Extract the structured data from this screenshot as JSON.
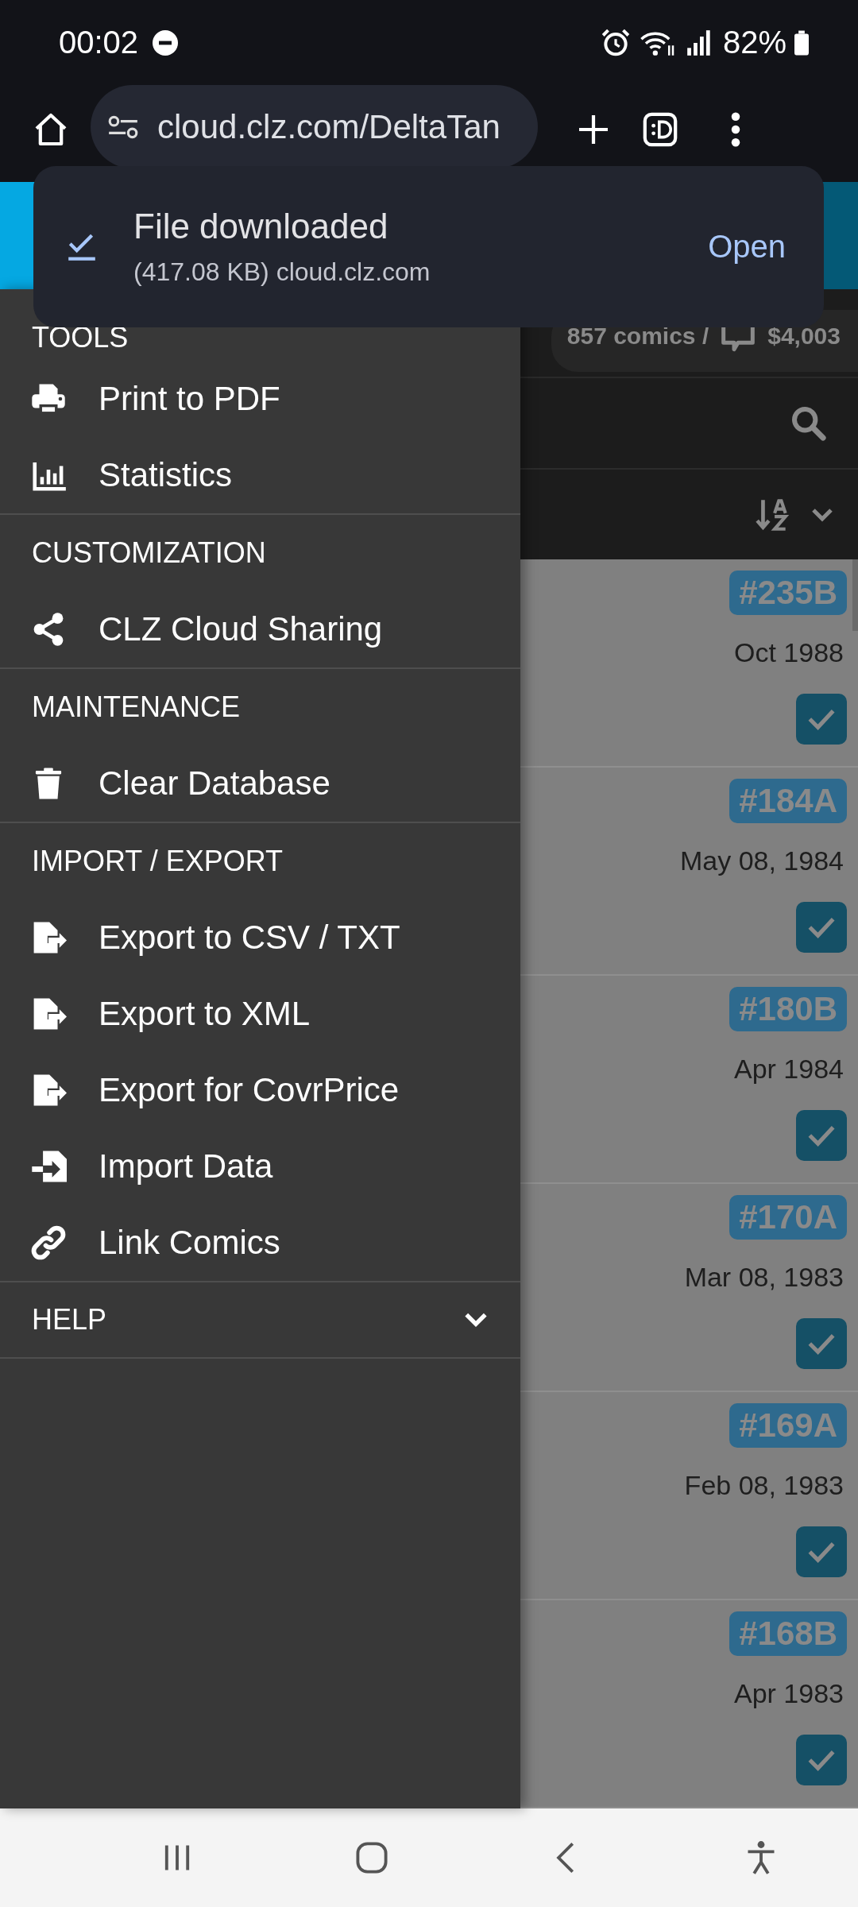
{
  "status_bar": {
    "time": "00:02",
    "battery": "82%"
  },
  "browser": {
    "url": "cloud.clz.com/DeltaTan"
  },
  "download_notice": {
    "title": "File downloaded",
    "detail": "(417.08 KB) cloud.clz.com",
    "action": "Open"
  },
  "collection_summary": {
    "count": "857 comics /",
    "value": "$4,003"
  },
  "drawer": {
    "sections": [
      {
        "heading": "TOOLS",
        "items": [
          {
            "label": "Print to PDF"
          },
          {
            "label": "Statistics"
          }
        ]
      },
      {
        "heading": "CUSTOMIZATION",
        "items": [
          {
            "label": "CLZ Cloud Sharing"
          }
        ]
      },
      {
        "heading": "MAINTENANCE",
        "items": [
          {
            "label": "Clear Database"
          }
        ]
      },
      {
        "heading": "IMPORT / EXPORT",
        "items": [
          {
            "label": "Export to CSV / TXT"
          },
          {
            "label": "Export to XML"
          },
          {
            "label": "Export for CovrPrice"
          },
          {
            "label": "Import Data"
          },
          {
            "label": "Link Comics"
          }
        ]
      }
    ],
    "help": {
      "label": "HELP",
      "expanded": false
    }
  },
  "comics": [
    {
      "issue": "#235B",
      "date": "Oct 1988",
      "checked": true
    },
    {
      "issue": "#184A",
      "date": "May 08, 1984",
      "checked": true
    },
    {
      "issue": "#180B",
      "date": "Apr 1984",
      "checked": true
    },
    {
      "issue": "#170A",
      "date": "Mar 08, 1983",
      "checked": true
    },
    {
      "issue": "#169A",
      "date": "Feb 08, 1983",
      "checked": true
    },
    {
      "issue": "#168B",
      "date": "Apr 1983",
      "checked": true
    }
  ]
}
